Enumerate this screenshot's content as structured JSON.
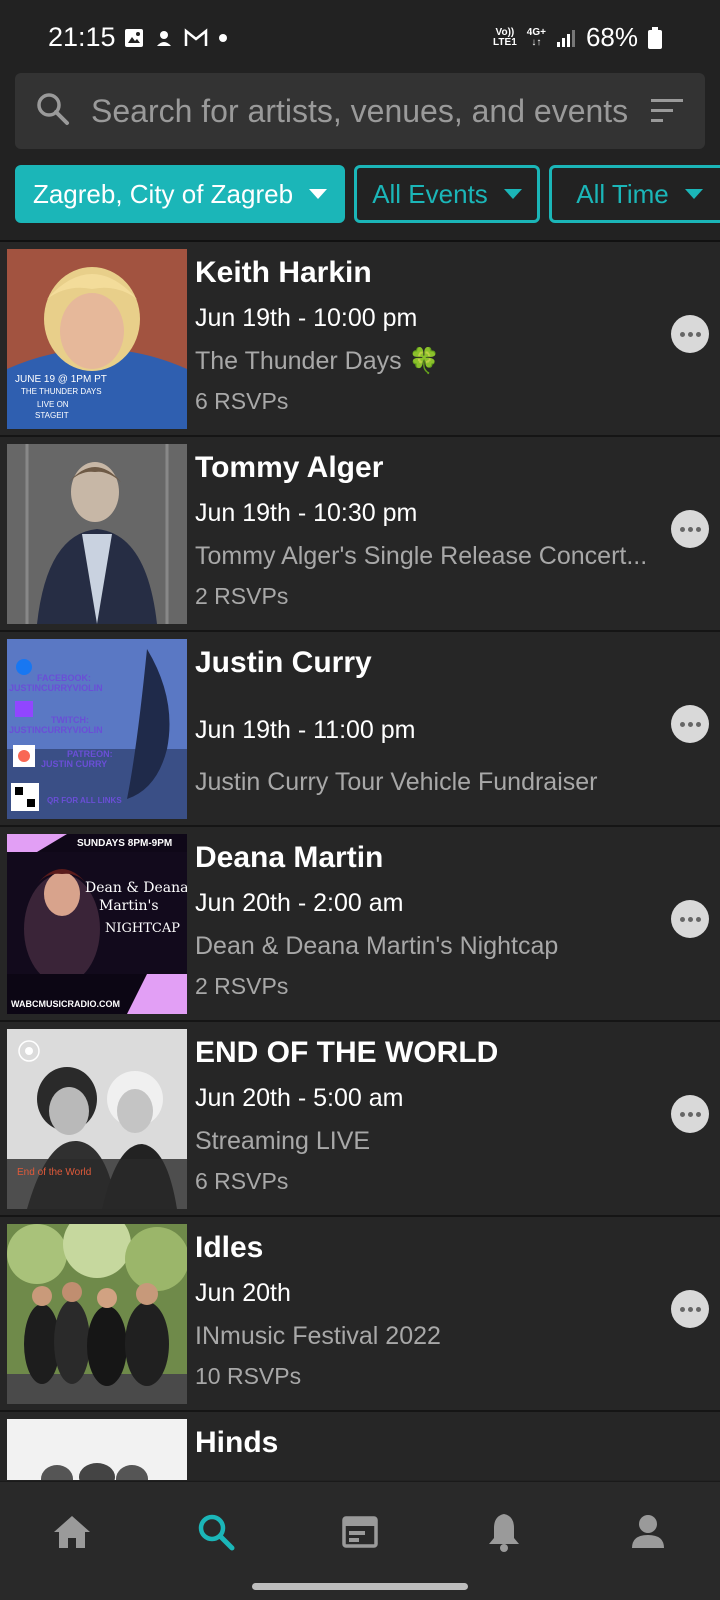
{
  "status_bar": {
    "time": "21:15",
    "battery": "68%",
    "network_top": "Vo))",
    "network_bottom": "LTE1",
    "network_gen": "4G+",
    "icons": [
      "image-icon",
      "pinwheel-icon",
      "gmail-icon",
      "dot-icon",
      "signal-icon",
      "battery-icon"
    ]
  },
  "search": {
    "placeholder": "Search for artists, venues, and events"
  },
  "filters": {
    "location": "Zagreb, City of Zagreb",
    "event_type": "All Events",
    "time": "All Time"
  },
  "colors": {
    "accent": "#1bb6b8",
    "background": "#222222",
    "row_background": "#262626",
    "muted_text": "#a8a8a8"
  },
  "events": [
    {
      "title": "Keith Harkin",
      "date": "Jun 19th - 10:00 pm",
      "description": "The Thunder Days 🍀",
      "rsvps": "6 RSVPs",
      "thumb_caption": "JUNE 19 @ 1PM PT",
      "thumb_caption_2": "THE THUNDER DAYS",
      "thumb_caption_3": "LIVE ON",
      "thumb_caption_4": "STAGEIT"
    },
    {
      "title": "Tommy Alger",
      "date": "Jun 19th - 10:30 pm",
      "description": "Tommy Alger's Single Release Concert...",
      "rsvps": "2 RSVPs"
    },
    {
      "title": "Justin Curry",
      "date": "Jun 19th - 11:00 pm",
      "description": "Justin Curry Tour Vehicle Fundraiser",
      "rsvps": "",
      "thumb_line_1": "FACEBOOK:",
      "thumb_line_2": "JUSTINCURRYVIOLIN",
      "thumb_line_3": "TWITCH:",
      "thumb_line_4": "JUSTINCURRYVIOLIN",
      "thumb_line_5": "PATREON:",
      "thumb_line_6": "JUSTIN CURRY",
      "thumb_line_7": "QR FOR ALL LINKS"
    },
    {
      "title": "Deana Martin",
      "date": "Jun 20th - 2:00 am",
      "description": "Dean & Deana Martin's Nightcap",
      "rsvps": "2 RSVPs",
      "thumb_top": "SUNDAYS 8PM-9PM",
      "thumb_title_1": "Dean & Deana",
      "thumb_title_2": "Martin's",
      "thumb_title_3": "NIGHTCAP",
      "thumb_bottom": "WABCMUSICRADIO.COM"
    },
    {
      "title": "END OF THE WORLD",
      "date": "Jun 20th - 5:00 am",
      "description": "Streaming LIVE",
      "rsvps": "6 RSVPs",
      "thumb_caption": "End of the World"
    },
    {
      "title": "Idles",
      "date": "Jun 20th",
      "description": "INmusic Festival 2022",
      "rsvps": "10 RSVPs"
    },
    {
      "title": "Hinds",
      "date": "",
      "description": "",
      "rsvps": ""
    }
  ],
  "bottom_nav": {
    "items": [
      "home-icon",
      "search-icon",
      "tickets-icon",
      "bell-icon",
      "profile-icon"
    ],
    "active": "search-icon"
  }
}
